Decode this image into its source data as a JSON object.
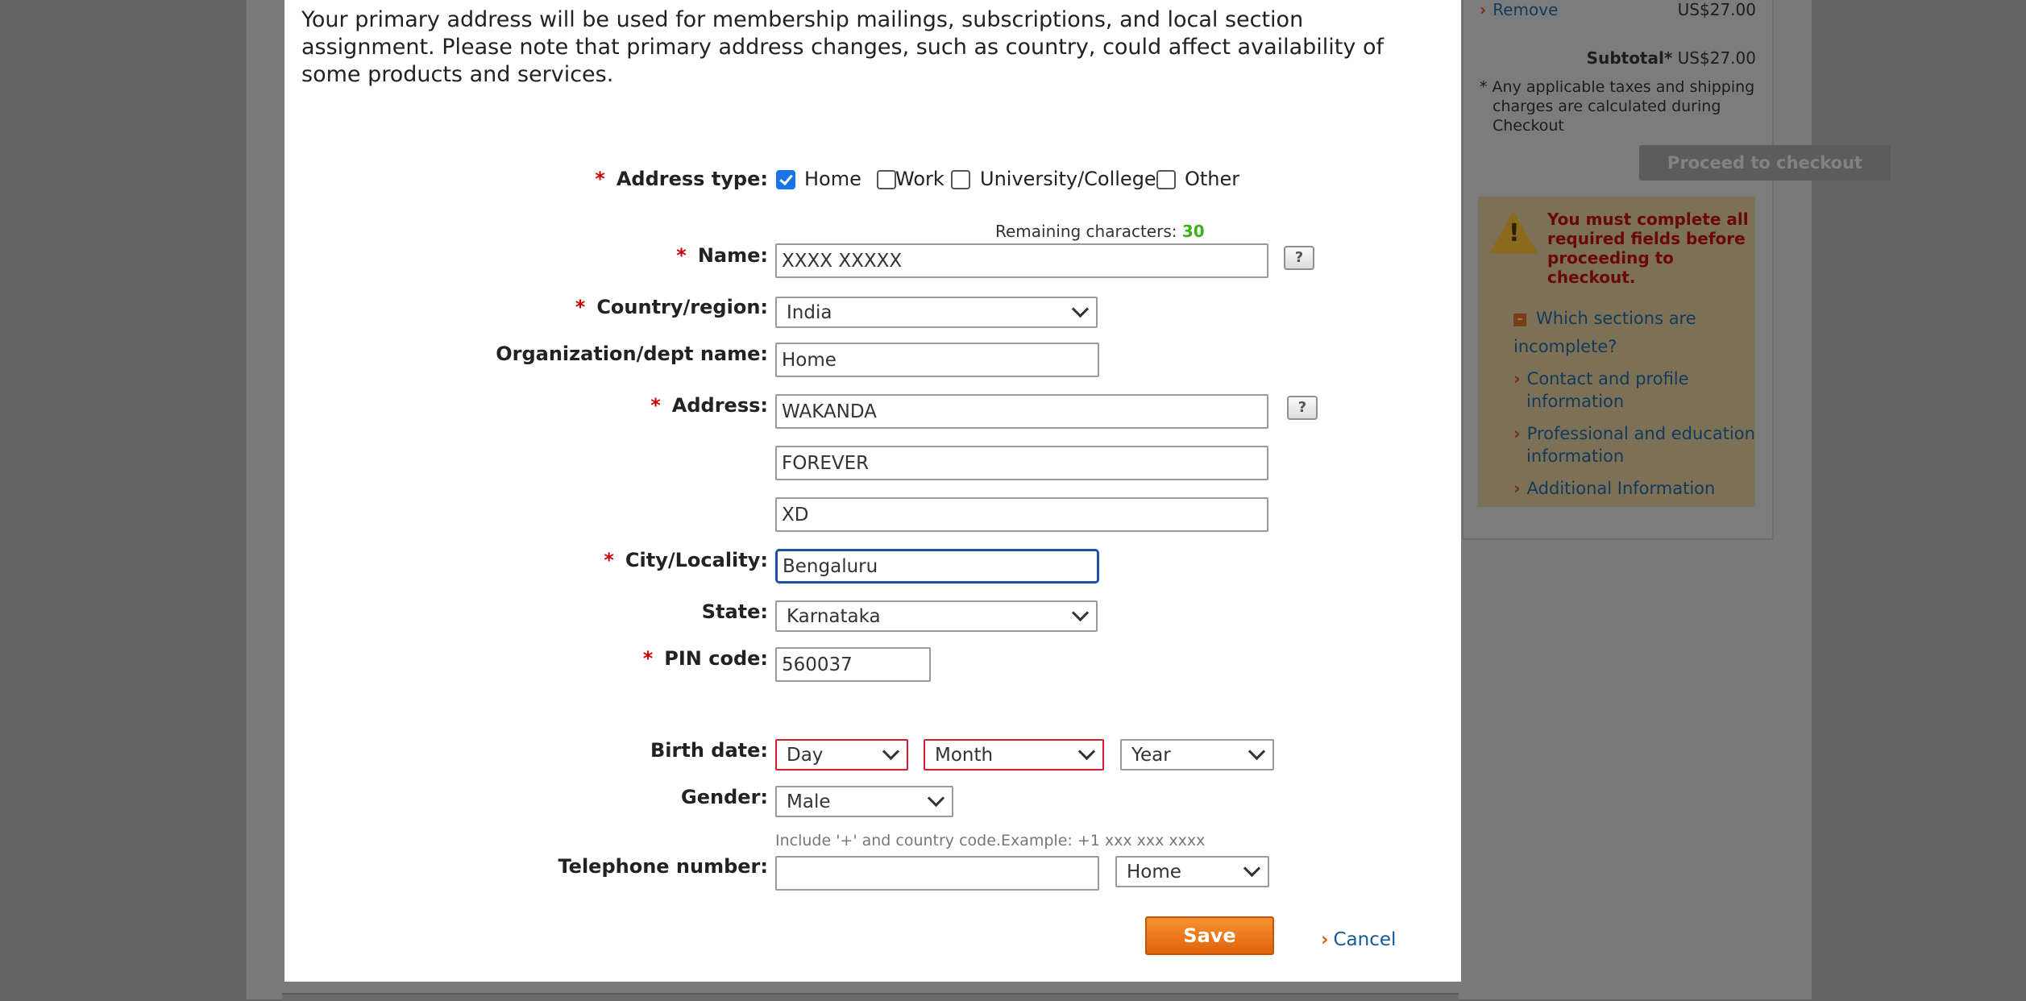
{
  "cart": {
    "remove_label": "Remove",
    "item_price": "US$27.00",
    "subtotal_label": "Subtotal*",
    "subtotal_value": "US$27.00",
    "tax_note_marker": "*",
    "tax_note": "Any applicable taxes and shipping charges are calculated during Checkout",
    "checkout_button": "Proceed to checkout",
    "warning": {
      "icon": "warning-triangle-icon",
      "message": "You must complete all required fields before proceeding to checkout.",
      "toggle_marker": "–",
      "question": "Which sections are incomplete?",
      "links": [
        "Contact and profile information",
        "Professional and education information",
        "Additional Information"
      ]
    }
  },
  "modal": {
    "intro": "Your primary address will be used for membership mailings, subscriptions, and local section assignment. Please note that primary address changes, such as country, could affect availability of some products and services.",
    "required_marker": "*",
    "address_type": {
      "label": "Address type:",
      "options": [
        {
          "label": "Home",
          "checked": true
        },
        {
          "label": "Work",
          "checked": false
        },
        {
          "label": "University/College",
          "checked": false
        },
        {
          "label": "Other",
          "checked": false
        }
      ]
    },
    "remaining_chars_label": "Remaining characters:",
    "remaining_chars_value": "30",
    "name": {
      "label": "Name:",
      "value": "XXXX XXXXX"
    },
    "help_glyph": "?",
    "country": {
      "label": "Country/region:",
      "value": "India"
    },
    "organization": {
      "label": "Organization/dept name:",
      "value": "Home"
    },
    "address": {
      "label": "Address:",
      "line1": "WAKANDA",
      "line2": "FOREVER",
      "line3": "XD"
    },
    "city": {
      "label": "City/Locality:",
      "value": "Bengaluru"
    },
    "state": {
      "label": "State:",
      "value": "Karnataka"
    },
    "pin": {
      "label": "PIN code:",
      "value": "560037"
    },
    "birth_date": {
      "label": "Birth date:",
      "day": "Day",
      "month": "Month",
      "year": "Year"
    },
    "gender": {
      "label": "Gender:",
      "value": "Male"
    },
    "telephone": {
      "label": "Telephone number:",
      "hint": "Include '+' and country code.Example: +1 xxx xxx xxxx",
      "value": "",
      "type": "Home"
    },
    "save_button": "Save",
    "cancel_link": "Cancel",
    "colors": {
      "required": "#cc0000",
      "save": "#f07a1c",
      "focus": "#1f4fa8",
      "error_border": "#d21e2e",
      "remaining_value": "#3cb21a"
    }
  }
}
